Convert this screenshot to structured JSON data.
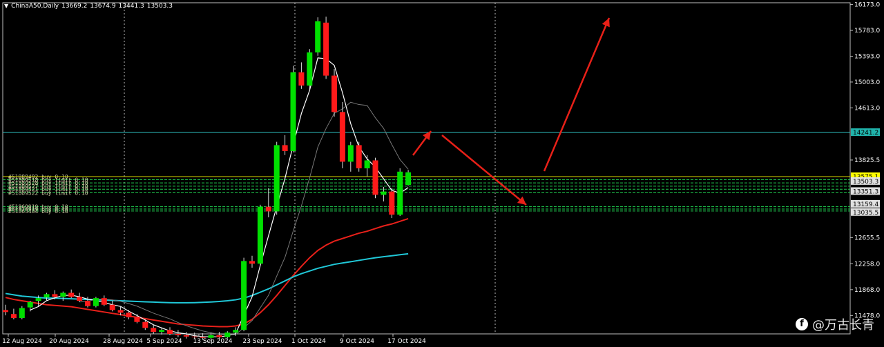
{
  "header": {
    "symbol": "ChinaA50,Daily",
    "open": "13669.2",
    "high": "13674.9",
    "low": "13441.3",
    "close": "13503.3"
  },
  "watermark": {
    "text": "@万古长青",
    "icon": "facebook-icon"
  },
  "colors": {
    "background": "#000000",
    "bull": "#00e000",
    "bear": "#ff1a1a",
    "ma_white": "#ffffff",
    "ma_red": "#e8201a",
    "ma_cyan": "#20c8d8",
    "level_line": "#2ec0c0",
    "order_line": "#20d050",
    "arrow": "#e82018"
  },
  "chart_data": {
    "type": "candlestick",
    "ylim": [
      11200,
      16200
    ],
    "y_ticks": [
      "16173.0",
      "15783.0",
      "15393.0",
      "15003.0",
      "14613.0",
      "13825.5",
      "12655.5",
      "12258.0",
      "11868.0",
      "11478.0"
    ],
    "x_ticks": [
      "12 Aug 2024",
      "20 Aug 2024",
      "28 Aug 2024",
      "5 Sep 2024",
      "13 Sep 2024",
      "23 Sep 2024",
      "1 Oct 2024",
      "9 Oct 2024",
      "17 Oct 2024"
    ],
    "price_labels": [
      {
        "text": "14241.2",
        "value": 14241.2,
        "bg": "#20b2aa"
      },
      {
        "text": "13575.1",
        "value": 13575.1,
        "bg": "#ffff00"
      },
      {
        "text": "13503.3",
        "value": 13503.3,
        "bg": "#e0e0e0"
      },
      {
        "text": "13351.3",
        "value": 13351.3,
        "bg": "#e0e0e0"
      },
      {
        "text": "13159.4",
        "value": 13159.4,
        "bg": "#e0e0e0"
      },
      {
        "text": "13035.5",
        "value": 13035.5,
        "bg": "#e0e0e0"
      }
    ],
    "order_labels": [
      {
        "text": "#51889492 buy 0.10",
        "value": 13575
      },
      {
        "text": "#51889518 buy limit 0.10",
        "value": 13530
      },
      {
        "text": "#51889528 buy limit 0.10",
        "value": 13480
      },
      {
        "text": "#51889527 buy limit 0.10",
        "value": 13430
      },
      {
        "text": "#51889521 buy limit 0.10",
        "value": 13385
      },
      {
        "text": "#51889522 buy limit 0.10",
        "value": 13330
      },
      {
        "text": "#51869919 buy 0.10",
        "value": 13120
      },
      {
        "text": "#51870919 buy 0.10",
        "value": 13085
      },
      {
        "text": "#51863404 buy 0.10",
        "value": 13055
      }
    ],
    "candles": [
      {
        "o": 11560,
        "h": 11640,
        "l": 11480,
        "c": 11530
      },
      {
        "o": 11500,
        "h": 11580,
        "l": 11420,
        "c": 11440
      },
      {
        "o": 11440,
        "h": 11620,
        "l": 11420,
        "c": 11590
      },
      {
        "o": 11600,
        "h": 11700,
        "l": 11540,
        "c": 11680
      },
      {
        "o": 11700,
        "h": 11780,
        "l": 11620,
        "c": 11740
      },
      {
        "o": 11750,
        "h": 11820,
        "l": 11700,
        "c": 11800
      },
      {
        "o": 11800,
        "h": 11860,
        "l": 11720,
        "c": 11760
      },
      {
        "o": 11760,
        "h": 11840,
        "l": 11700,
        "c": 11820
      },
      {
        "o": 11820,
        "h": 11870,
        "l": 11740,
        "c": 11760
      },
      {
        "o": 11760,
        "h": 11820,
        "l": 11680,
        "c": 11700
      },
      {
        "o": 11700,
        "h": 11760,
        "l": 11600,
        "c": 11620
      },
      {
        "o": 11620,
        "h": 11760,
        "l": 11600,
        "c": 11740
      },
      {
        "o": 11740,
        "h": 11780,
        "l": 11620,
        "c": 11640
      },
      {
        "o": 11640,
        "h": 11700,
        "l": 11540,
        "c": 11560
      },
      {
        "o": 11560,
        "h": 11620,
        "l": 11480,
        "c": 11520
      },
      {
        "o": 11520,
        "h": 11560,
        "l": 11420,
        "c": 11450
      },
      {
        "o": 11460,
        "h": 11500,
        "l": 11360,
        "c": 11380
      },
      {
        "o": 11380,
        "h": 11420,
        "l": 11260,
        "c": 11290
      },
      {
        "o": 11290,
        "h": 11340,
        "l": 11200,
        "c": 11230
      },
      {
        "o": 11230,
        "h": 11300,
        "l": 11190,
        "c": 11260
      },
      {
        "o": 11260,
        "h": 11300,
        "l": 11180,
        "c": 11200
      },
      {
        "o": 11200,
        "h": 11260,
        "l": 11150,
        "c": 11180
      },
      {
        "o": 11180,
        "h": 11230,
        "l": 11130,
        "c": 11160
      },
      {
        "o": 11160,
        "h": 11220,
        "l": 11120,
        "c": 11150
      },
      {
        "o": 11150,
        "h": 11210,
        "l": 11110,
        "c": 11140
      },
      {
        "o": 11140,
        "h": 11220,
        "l": 11110,
        "c": 11180
      },
      {
        "o": 11180,
        "h": 11230,
        "l": 11120,
        "c": 11150
      },
      {
        "o": 11150,
        "h": 11240,
        "l": 11130,
        "c": 11220
      },
      {
        "o": 11220,
        "h": 11300,
        "l": 11170,
        "c": 11260
      },
      {
        "o": 11260,
        "h": 12350,
        "l": 11240,
        "c": 12300
      },
      {
        "o": 12300,
        "h": 12380,
        "l": 12200,
        "c": 12260
      },
      {
        "o": 12260,
        "h": 13150,
        "l": 12240,
        "c": 13120
      },
      {
        "o": 13120,
        "h": 13400,
        "l": 12960,
        "c": 13050
      },
      {
        "o": 13050,
        "h": 14100,
        "l": 13000,
        "c": 14050
      },
      {
        "o": 14050,
        "h": 14200,
        "l": 13900,
        "c": 13960
      },
      {
        "o": 13960,
        "h": 15250,
        "l": 13940,
        "c": 15150
      },
      {
        "o": 15150,
        "h": 15300,
        "l": 14900,
        "c": 14950
      },
      {
        "o": 14950,
        "h": 15500,
        "l": 14880,
        "c": 15450
      },
      {
        "o": 15450,
        "h": 15980,
        "l": 15400,
        "c": 15920
      },
      {
        "o": 15900,
        "h": 15990,
        "l": 15050,
        "c": 15100
      },
      {
        "o": 15100,
        "h": 15200,
        "l": 14480,
        "c": 14550
      },
      {
        "o": 14550,
        "h": 14700,
        "l": 13700,
        "c": 13800
      },
      {
        "o": 13800,
        "h": 14100,
        "l": 13650,
        "c": 14050
      },
      {
        "o": 14050,
        "h": 14100,
        "l": 13650,
        "c": 13700
      },
      {
        "o": 13700,
        "h": 13900,
        "l": 13580,
        "c": 13820
      },
      {
        "o": 13820,
        "h": 13860,
        "l": 13250,
        "c": 13300
      },
      {
        "o": 13300,
        "h": 13420,
        "l": 13200,
        "c": 13350
      },
      {
        "o": 13350,
        "h": 13400,
        "l": 12950,
        "c": 13000
      },
      {
        "o": 13000,
        "h": 13700,
        "l": 12980,
        "c": 13650
      },
      {
        "o": 13450,
        "h": 13674.9,
        "l": 13441.3,
        "c": 13640
      }
    ],
    "series": [
      {
        "values": [
          11750,
          11720,
          11700,
          11680,
          11660,
          11640,
          11630,
          11620,
          11610,
          11590,
          11570,
          11550,
          11530,
          11510,
          11490,
          11470,
          11450,
          11430,
          11410,
          11390,
          11370,
          11350,
          11340,
          11330,
          11320,
          11315,
          11310,
          11310,
          11320,
          11350,
          11420,
          11520,
          11640,
          11780,
          11930,
          12080,
          12220,
          12350,
          12460,
          12540,
          12600,
          12640,
          12680,
          12720,
          12750,
          12790,
          12830,
          12860,
          12900,
          12940
        ]
      },
      {
        "values": [
          11810,
          11790,
          11770,
          11760,
          11750,
          11740,
          11740,
          11735,
          11730,
          11725,
          11720,
          11715,
          11710,
          11705,
          11700,
          11695,
          11690,
          11685,
          11680,
          11675,
          11672,
          11670,
          11670,
          11672,
          11676,
          11682,
          11690,
          11700,
          11715,
          11740,
          11780,
          11830,
          11880,
          11940,
          12000,
          12060,
          12110,
          12150,
          12190,
          12220,
          12250,
          12270,
          12290,
          12310,
          12330,
          12350,
          12365,
          12380,
          12395,
          12410
        ]
      }
    ],
    "annotations": [
      {
        "type": "arrow",
        "from": [
          1120,
          13750
        ],
        "to": [
          1185,
          14150
        ]
      },
      {
        "type": "arrow",
        "from": [
          1200,
          14000
        ],
        "to": [
          1425,
          13050
        ]
      },
      {
        "type": "arrow",
        "from": [
          1440,
          13520
        ],
        "to": [
          1590,
          16000
        ]
      }
    ],
    "grid": "vertical dashed"
  }
}
